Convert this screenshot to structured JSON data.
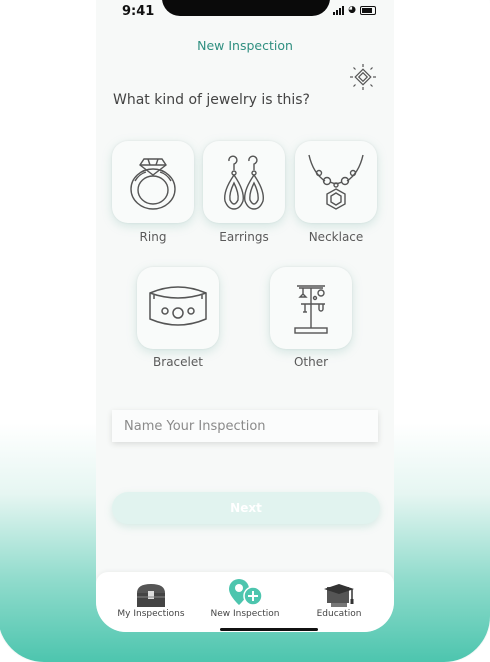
{
  "status_bar": {
    "time": "9:41"
  },
  "header": {
    "title": "New Inspection"
  },
  "question": "What kind of jewelry is this?",
  "jewelry_types": [
    {
      "label": "Ring",
      "icon": "ring-icon"
    },
    {
      "label": "Earrings",
      "icon": "earrings-icon"
    },
    {
      "label": "Necklace",
      "icon": "necklace-icon"
    },
    {
      "label": "Bracelet",
      "icon": "bracelet-icon"
    },
    {
      "label": "Other",
      "icon": "jewelry-stand-icon"
    }
  ],
  "name_input": {
    "placeholder": "Name Your Inspection",
    "value": ""
  },
  "next_button": {
    "label": "Next"
  },
  "tab_bar": {
    "tabs": [
      {
        "label": "My Inspections",
        "icon": "treasure-chest-icon"
      },
      {
        "label": "New Inspection",
        "icon": "add-location-icon"
      },
      {
        "label": "Education",
        "icon": "graduation-cap-icon"
      }
    ]
  },
  "colors": {
    "accent": "#2f8f80",
    "teal": "#4dc5ae",
    "button_bg": "#e1f3ef"
  }
}
